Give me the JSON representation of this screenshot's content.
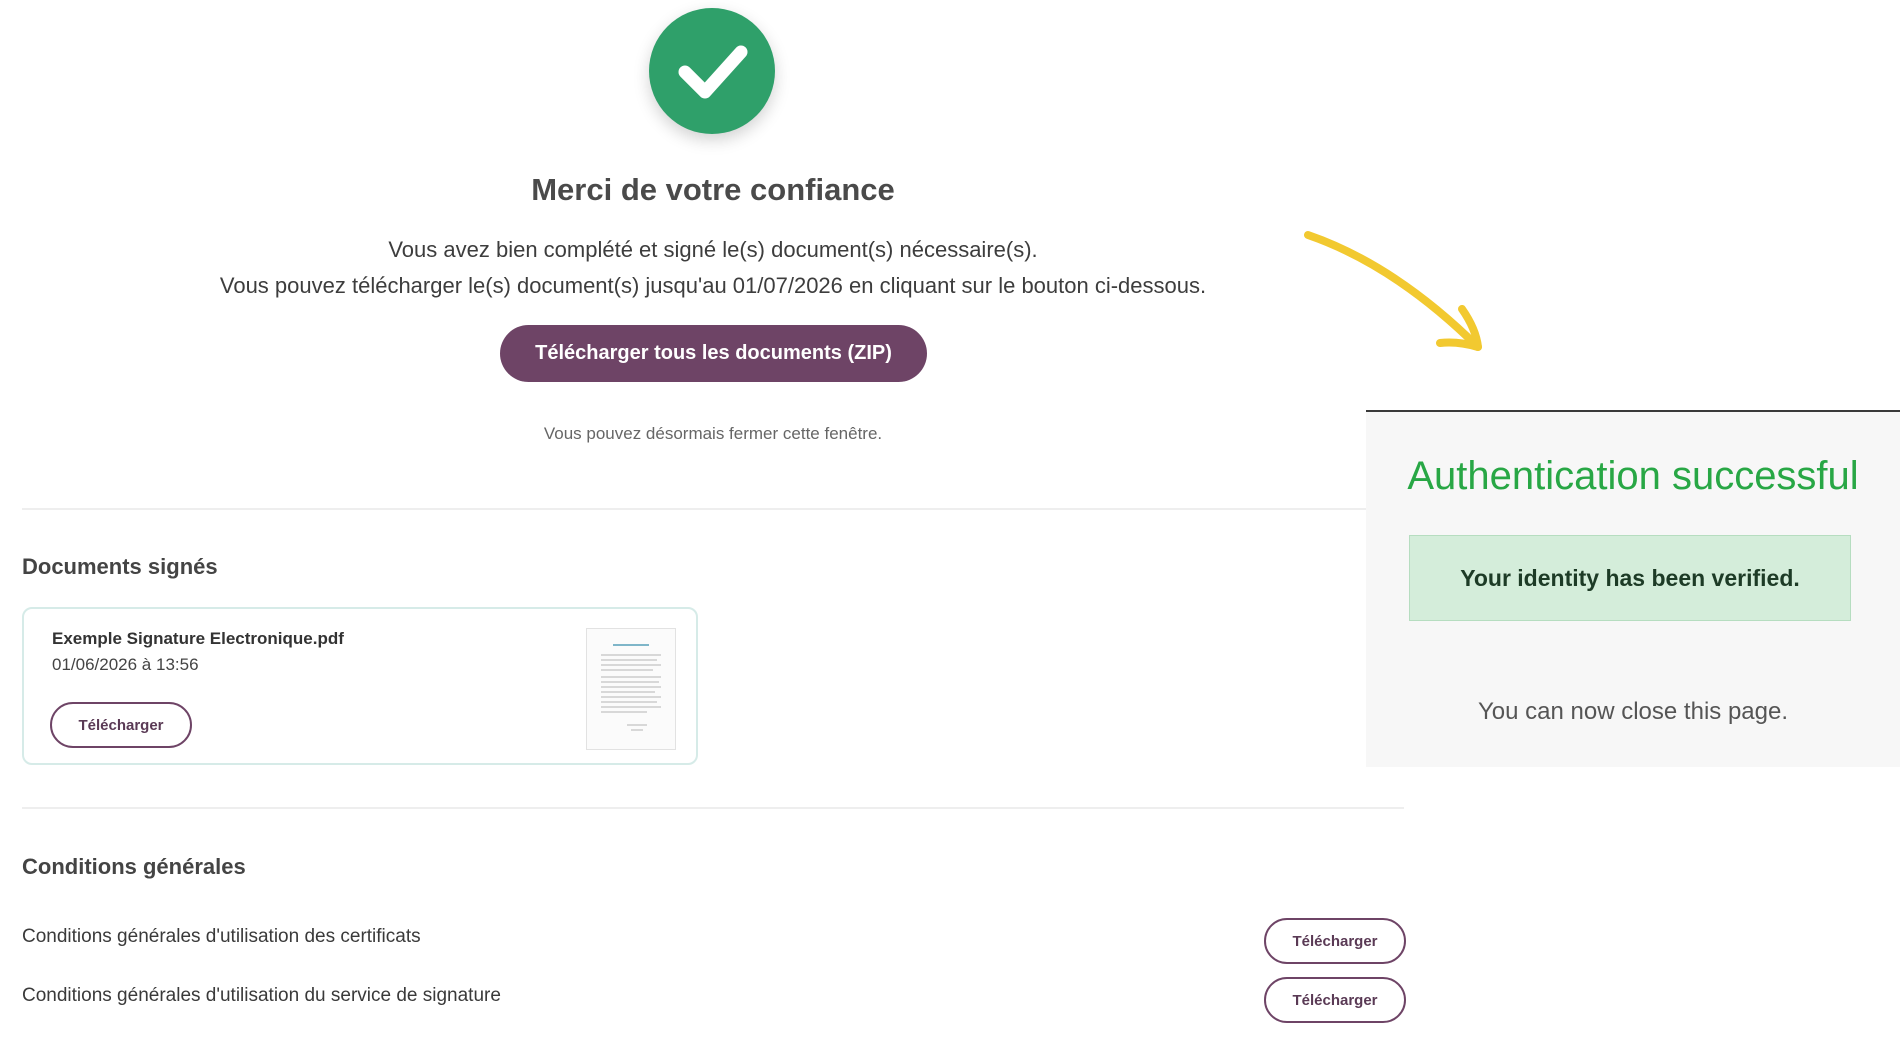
{
  "success": {
    "icon": "checkmark-icon",
    "title": "Merci de votre confiance",
    "line1": "Vous avez bien complété et signé le(s) document(s) nécessaire(s).",
    "line2": "Vous pouvez télécharger le(s) document(s) jusqu'au 01/07/2026 en cliquant sur le bouton ci-dessous.",
    "zip_button": "Télécharger tous les documents (ZIP)",
    "close_note": "Vous pouvez désormais fermer cette fenêtre."
  },
  "signed_documents": {
    "title": "Documents signés",
    "items": [
      {
        "name": "Exemple Signature Electronique.pdf",
        "date": "01/06/2026 à 13:56",
        "button": "Télécharger"
      }
    ]
  },
  "conditions": {
    "title": "Conditions générales",
    "items": [
      {
        "label": "Conditions générales d'utilisation des certificats",
        "button": "Télécharger"
      },
      {
        "label": "Conditions générales d'utilisation du service de signature",
        "button": "Télécharger"
      }
    ]
  },
  "auth": {
    "title": "Authentication successful",
    "verified": "Your identity has been verified.",
    "note": "You can now close this page."
  },
  "colors": {
    "success_green": "#2fa06a",
    "brand_purple": "#6e4466",
    "auth_green": "#28a745",
    "alert_bg": "#d4edda",
    "arrow_yellow": "#f2c930"
  }
}
